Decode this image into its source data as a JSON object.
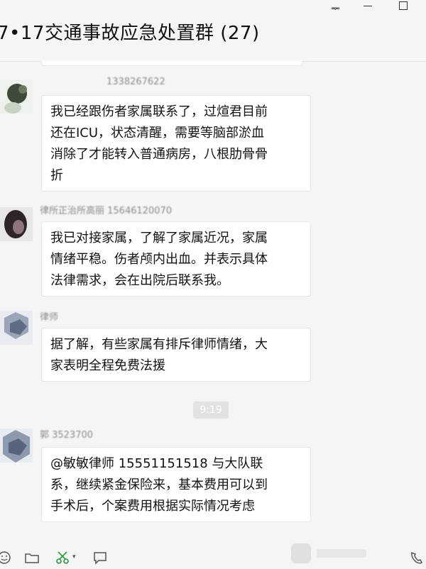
{
  "window": {
    "title": "7•17交通事故应急处置群 (27)",
    "pin_glyph": "ᆓ",
    "colors": {
      "background": "#f5f5f5",
      "bubble": "#ffffff",
      "timestamp_bg": "#e2e2e2"
    }
  },
  "messages": [
    {
      "sender": "1338267622",
      "text_lines": [
        "我已经跟伤者家属联系了，过煊君目前",
        "还在ICU，状态清醒，需要等脑部淤血",
        "消除了才能转入普通病房，八根肋骨骨",
        "折"
      ]
    },
    {
      "sender": "律所正治所高丽 15646120070",
      "text_lines": [
        "我已对接家属，了解了家属近况，家属",
        "情绪平稳。伤者颅内出血。并表示具体",
        "法律需求，会在出院后联系我。"
      ]
    },
    {
      "sender": "律师",
      "text_lines": [
        "据了解，有些家属有排斥律师情绪，大",
        "家表明全程免费法援"
      ]
    },
    {
      "sender": "郭 3523700",
      "text_lines": [
        "@敏敏律师 15551151518 与大队联",
        "系，继续紧金保险来，基本费用可以到",
        "手术后，个案费用根据实际情况考虑"
      ]
    }
  ],
  "timestamp": "9:19",
  "toolbar": {
    "icons": [
      "emoji-icon",
      "folder-icon",
      "scissors-icon",
      "chat-bubble-icon",
      "phone-icon"
    ]
  }
}
